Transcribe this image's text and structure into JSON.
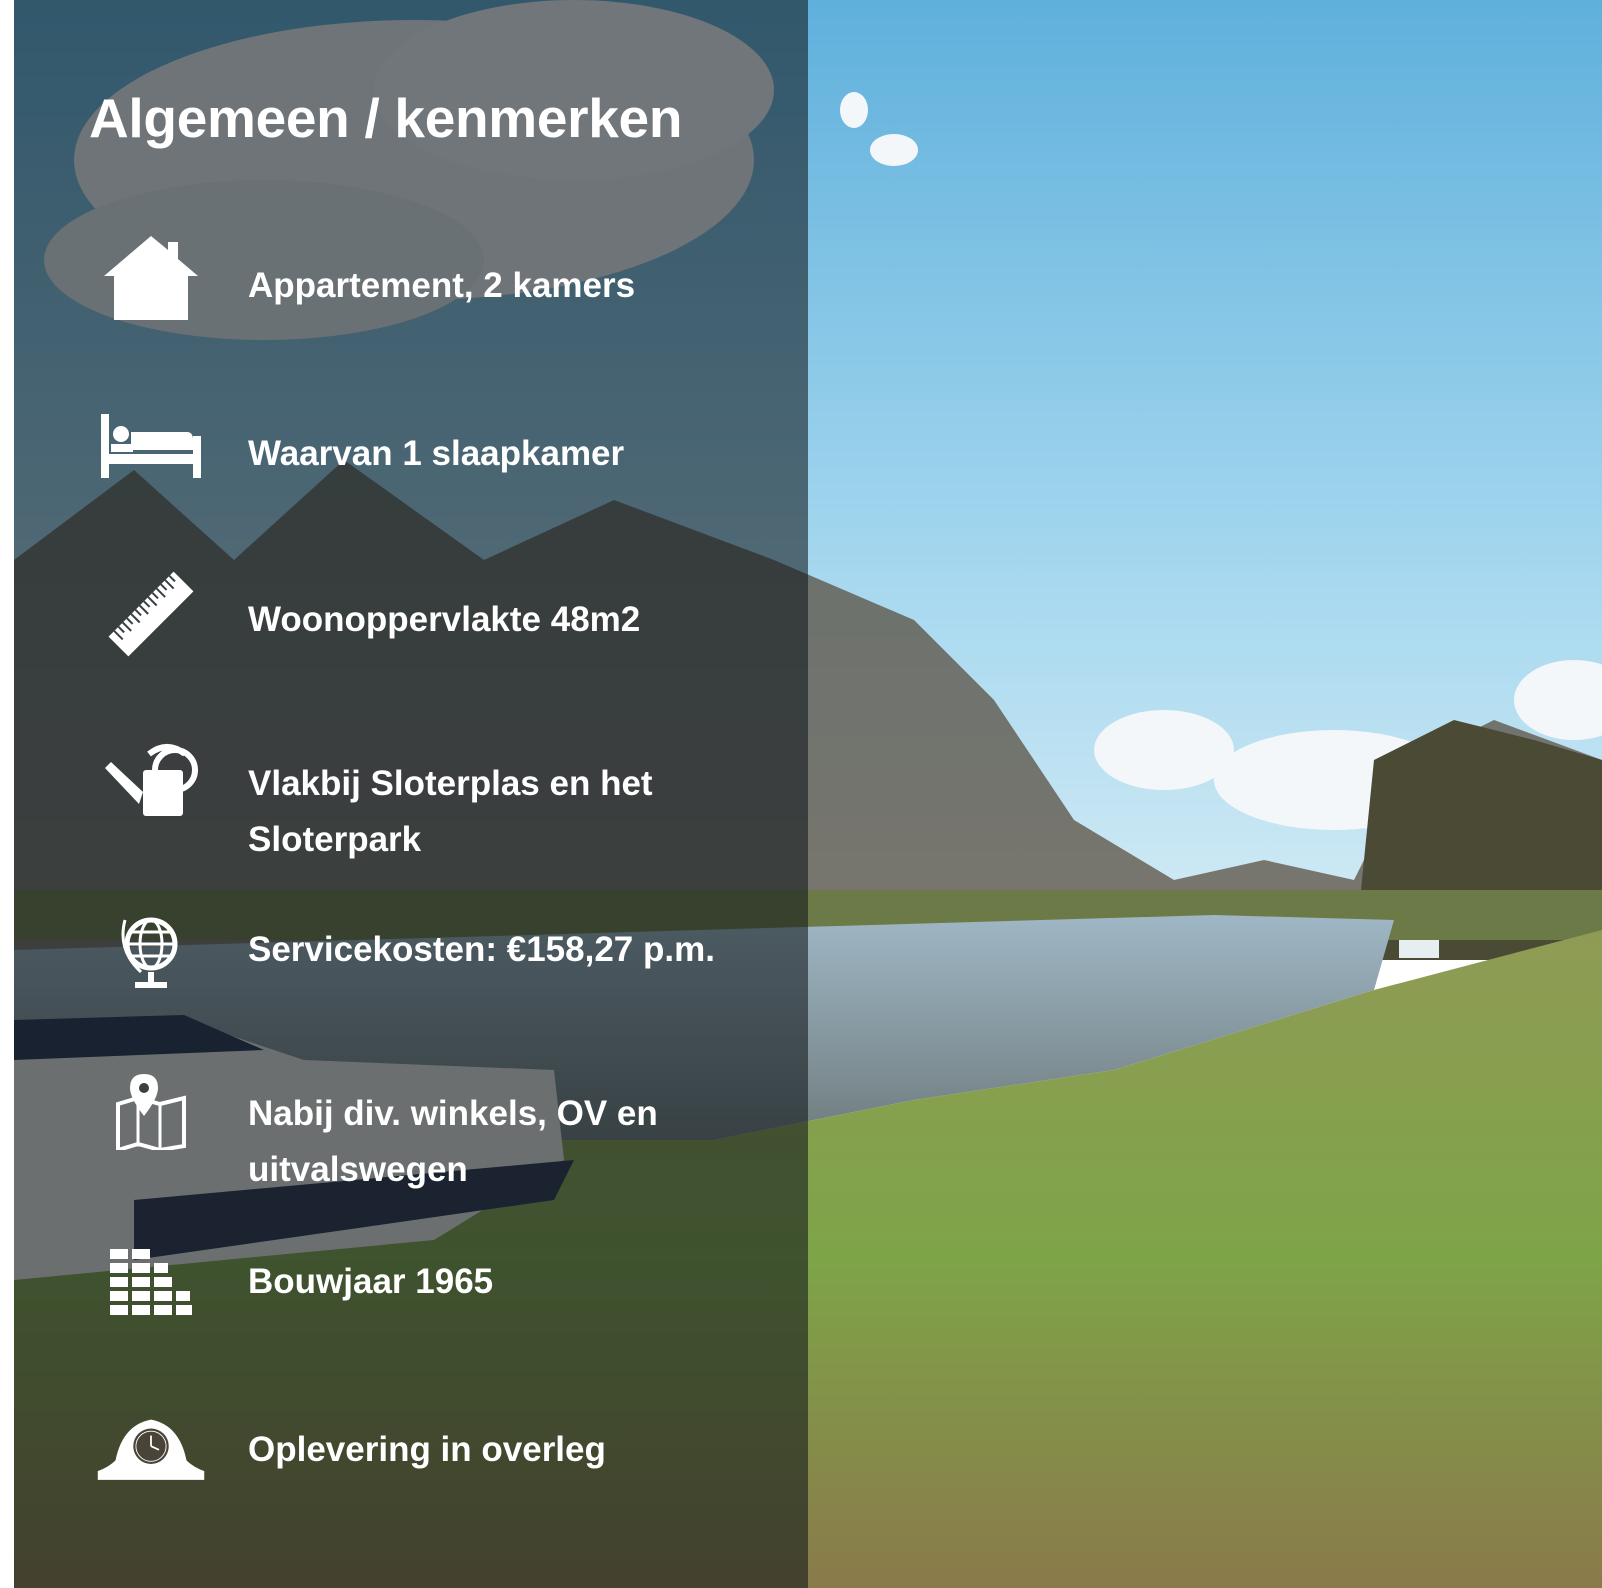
{
  "title": "Algemeen / kenmerken",
  "features": [
    {
      "icon": "house-icon",
      "text": "Appartement, 2 kamers"
    },
    {
      "icon": "bed-icon",
      "text": "Waarvan 1 slaapkamer"
    },
    {
      "icon": "ruler-icon",
      "text": "Woonoppervlakte 48m2"
    },
    {
      "icon": "watering-can-icon",
      "text": "Vlakbij Sloterplas en het Sloterpark"
    },
    {
      "icon": "globe-icon",
      "text": "Servicekosten: €158,27 p.m."
    },
    {
      "icon": "map-pin-icon",
      "text": "Nabij div. winkels, OV en uitvalswegen"
    },
    {
      "icon": "bricks-icon",
      "text": "Bouwjaar 1965"
    },
    {
      "icon": "mantel-clock-icon",
      "text": "Oplevering in overleg"
    }
  ],
  "colors": {
    "overlay": "#12181c",
    "text": "#ffffff",
    "sky": "#7cc3e6",
    "grass": "#7e9a4a"
  }
}
